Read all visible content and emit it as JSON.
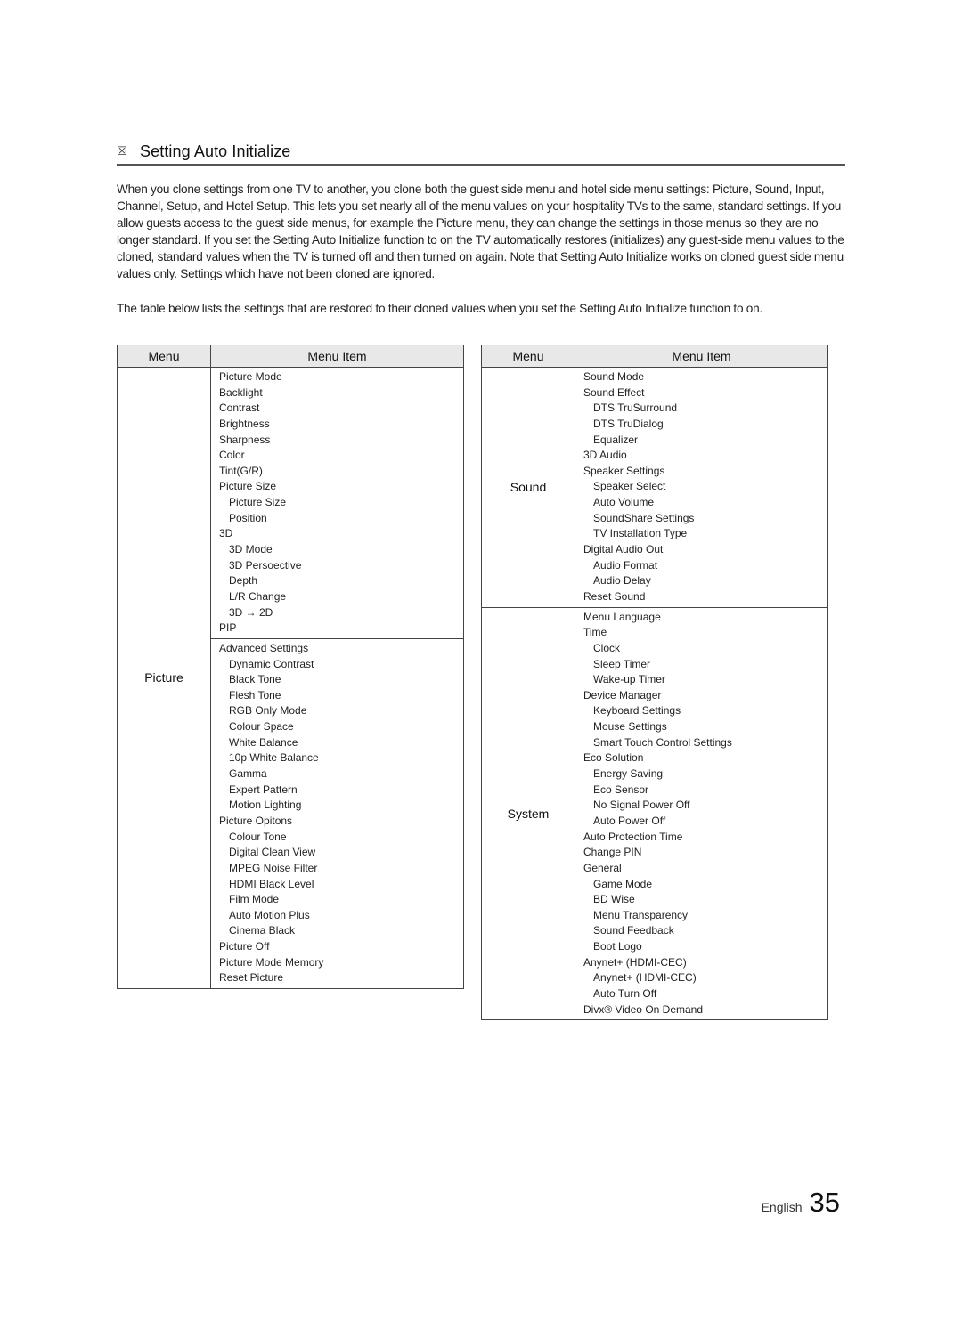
{
  "section": {
    "marker_icon": "☒",
    "title": "Setting Auto Initialize"
  },
  "intro": {
    "paragraph1": "When you clone settings from one TV to another, you clone both the guest side menu and hotel side menu settings: Picture, Sound, Input, Channel, Setup, and Hotel Setup. This lets you set nearly all of the menu values on your hospitality TVs to the same, standard settings. If you allow guests access to the guest side menus, for example the Picture menu, they can change the settings in those menus so they are no longer standard. If you set the Setting Auto Initialize function to on the TV automatically restores (initializes) any guest-side menu values to the cloned, standard values when the TV is turned off and then turned on again. Note that Setting Auto Initialize works on cloned guest side menu values only. Settings which have not been cloned are ignored.",
    "paragraph2": "The table below lists the settings that are restored to their cloned values when you set the Setting Auto Initialize function to on."
  },
  "tables": {
    "headers": {
      "menu": "Menu",
      "menu_item": "Menu Item"
    },
    "left": {
      "rows": [
        {
          "menu": "Picture",
          "groups": [
            [
              {
                "label": "Picture Mode",
                "level": 0
              },
              {
                "label": "Backlight",
                "level": 0
              },
              {
                "label": "Contrast",
                "level": 0
              },
              {
                "label": "Brightness",
                "level": 0
              },
              {
                "label": "Sharpness",
                "level": 0
              },
              {
                "label": "Color",
                "level": 0
              },
              {
                "label": "Tint(G/R)",
                "level": 0
              },
              {
                "label": "Picture Size",
                "level": 0
              },
              {
                "label": "Picture Size",
                "level": 1
              },
              {
                "label": "Position",
                "level": 1
              },
              {
                "label": "3D",
                "level": 0
              },
              {
                "label": "3D Mode",
                "level": 1
              },
              {
                "label": "3D Persoective",
                "level": 1
              },
              {
                "label": "Depth",
                "level": 1
              },
              {
                "label": "L/R Change",
                "level": 1
              },
              {
                "label": "3D → 2D",
                "level": 1
              },
              {
                "label": "PIP",
                "level": 0
              }
            ],
            [
              {
                "label": "Advanced Settings",
                "level": 0
              },
              {
                "label": "Dynamic Contrast",
                "level": 1
              },
              {
                "label": "Black Tone",
                "level": 1
              },
              {
                "label": "Flesh Tone",
                "level": 1
              },
              {
                "label": "RGB Only Mode",
                "level": 1
              },
              {
                "label": "Colour Space",
                "level": 1
              },
              {
                "label": "White Balance",
                "level": 1
              },
              {
                "label": "10p White Balance",
                "level": 1
              },
              {
                "label": "Gamma",
                "level": 1
              },
              {
                "label": "Expert Pattern",
                "level": 1
              },
              {
                "label": "Motion Lighting",
                "level": 1
              },
              {
                "label": "Picture Opitons",
                "level": 0
              },
              {
                "label": "Colour Tone",
                "level": 1
              },
              {
                "label": "Digital Clean View",
                "level": 1
              },
              {
                "label": "MPEG Noise Filter",
                "level": 1
              },
              {
                "label": "HDMI Black Level",
                "level": 1
              },
              {
                "label": "Film Mode",
                "level": 1
              },
              {
                "label": "Auto Motion Plus",
                "level": 1
              },
              {
                "label": "Cinema Black",
                "level": 1
              },
              {
                "label": "Picture Off",
                "level": 0
              },
              {
                "label": "Picture Mode Memory",
                "level": 0
              },
              {
                "label": "Reset Picture",
                "level": 0
              }
            ]
          ]
        }
      ]
    },
    "right": {
      "rows": [
        {
          "menu": "Sound",
          "items": [
            {
              "label": "Sound Mode",
              "level": 0
            },
            {
              "label": "Sound Effect",
              "level": 0
            },
            {
              "label": "DTS TruSurround",
              "level": 1
            },
            {
              "label": "DTS TruDialog",
              "level": 1
            },
            {
              "label": "Equalizer",
              "level": 1
            },
            {
              "label": "3D Audio",
              "level": 0
            },
            {
              "label": "Speaker Settings",
              "level": 0
            },
            {
              "label": "Speaker Select",
              "level": 1
            },
            {
              "label": "Auto Volume",
              "level": 1
            },
            {
              "label": "SoundShare Settings",
              "level": 1
            },
            {
              "label": "TV Installation Type",
              "level": 1
            },
            {
              "label": "Digital Audio Out",
              "level": 0
            },
            {
              "label": "Audio Format",
              "level": 1
            },
            {
              "label": "Audio Delay",
              "level": 1
            },
            {
              "label": "Reset Sound",
              "level": 0
            }
          ]
        },
        {
          "menu": "System",
          "items": [
            {
              "label": "Menu Language",
              "level": 0
            },
            {
              "label": "Time",
              "level": 0
            },
            {
              "label": "Clock",
              "level": 1
            },
            {
              "label": "Sleep Timer",
              "level": 1
            },
            {
              "label": "Wake-up Timer",
              "level": 1
            },
            {
              "label": "Device Manager",
              "level": 0
            },
            {
              "label": "Keyboard Settings",
              "level": 1
            },
            {
              "label": "Mouse Settings",
              "level": 1
            },
            {
              "label": "Smart Touch Control Settings",
              "level": 1
            },
            {
              "label": "Eco Solution",
              "level": 0
            },
            {
              "label": "Energy Saving",
              "level": 1
            },
            {
              "label": "Eco Sensor",
              "level": 1
            },
            {
              "label": "No Signal Power Off",
              "level": 1
            },
            {
              "label": "Auto Power Off",
              "level": 1
            },
            {
              "label": "Auto Protection Time",
              "level": 0
            },
            {
              "label": "Change PIN",
              "level": 0
            },
            {
              "label": "General",
              "level": 0
            },
            {
              "label": "Game Mode",
              "level": 1
            },
            {
              "label": "BD Wise",
              "level": 1
            },
            {
              "label": "Menu Transparency",
              "level": 1
            },
            {
              "label": "Sound Feedback",
              "level": 1
            },
            {
              "label": "Boot Logo",
              "level": 1
            },
            {
              "label": "Anynet+ (HDMI-CEC)",
              "level": 0
            },
            {
              "label": "Anynet+ (HDMI-CEC)",
              "level": 1
            },
            {
              "label": "Auto Turn Off",
              "level": 1
            },
            {
              "label": "Divx® Video On Demand",
              "level": 0
            }
          ]
        }
      ]
    }
  },
  "footer": {
    "language": "English",
    "page_number": "35"
  }
}
